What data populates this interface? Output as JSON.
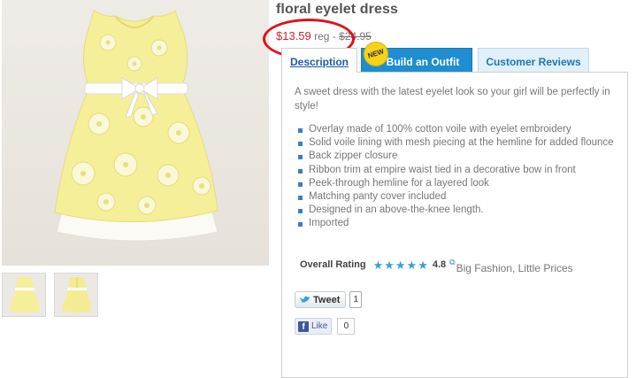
{
  "product": {
    "title": "floral eyelet dress",
    "price": "$13.59",
    "reg_label": "reg -",
    "old_price": "$24.95"
  },
  "tabs": {
    "description": "Description",
    "new_badge": "NEW",
    "build_outfit": "Build an Outfit",
    "reviews": "Customer Reviews"
  },
  "description": {
    "intro": "A sweet dress with the latest eyelet look so your girl will be perfectly in style!",
    "features": [
      "Overlay made of 100% cotton voile with eyelet embroidery",
      "Solid voile lining with mesh piecing at the hemline for added flounce",
      "Back zipper closure",
      "Ribbon trim at empire waist tied in a decorative bow in front",
      "Peek-through hemline for a layered look",
      "Matching panty cover included",
      "Designed in an above-the-knee length.",
      "Imported"
    ]
  },
  "rating": {
    "label": "Overall Rating",
    "stars": 5,
    "value": "4.8",
    "tagline": "Big Fashion, Little Prices"
  },
  "social": {
    "tweet_label": "Tweet",
    "tweet_count": "1",
    "like_label": "Like",
    "like_count": "0"
  },
  "colors": {
    "price_red": "#d3222a",
    "accent_blue": "#1f8ed0",
    "dress_yellow": "#f6ef9a"
  },
  "icons": {
    "star": "star-icon",
    "external": "external-link-icon",
    "twitter": "twitter-bird-icon",
    "facebook": "facebook-icon"
  }
}
